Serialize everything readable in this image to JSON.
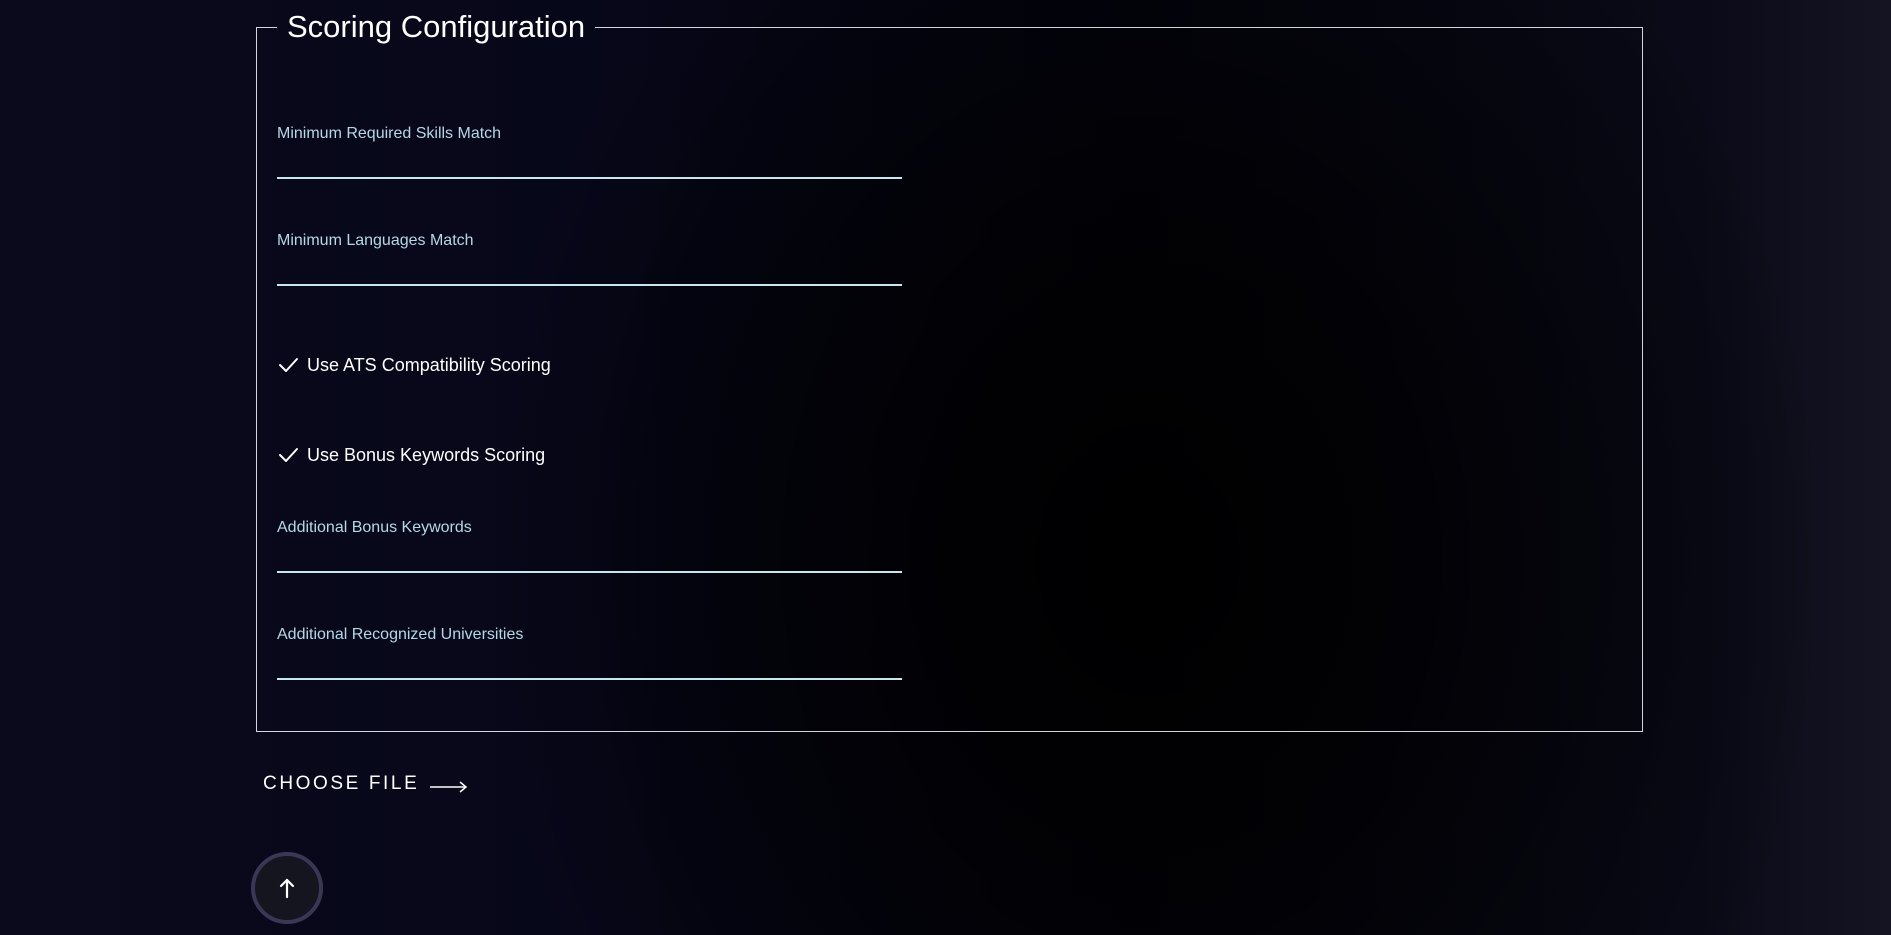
{
  "scoring": {
    "title": "Scoring Configuration",
    "fields": {
      "min_skills": {
        "label": "Minimum Required Skills Match",
        "value": ""
      },
      "min_languages": {
        "label": "Minimum Languages Match",
        "value": ""
      },
      "bonus_keywords": {
        "label": "Additional Bonus Keywords",
        "value": ""
      },
      "universities": {
        "label": "Additional Recognized Universities",
        "value": ""
      }
    },
    "checkboxes": {
      "ats": {
        "label": "Use ATS Compatibility Scoring",
        "checked": true
      },
      "bonus": {
        "label": "Use Bonus Keywords Scoring",
        "checked": true
      }
    }
  },
  "upload": {
    "choose_file_label": "CHOOSE FILE",
    "icon": "arrow-right-icon"
  },
  "scroll_top": {
    "icon": "arrow-up-icon"
  },
  "colors": {
    "label": "#b4d8e6",
    "underline": "#c6e7ee",
    "border": "#d4d4de",
    "scroll_ring": "#3a3756"
  }
}
